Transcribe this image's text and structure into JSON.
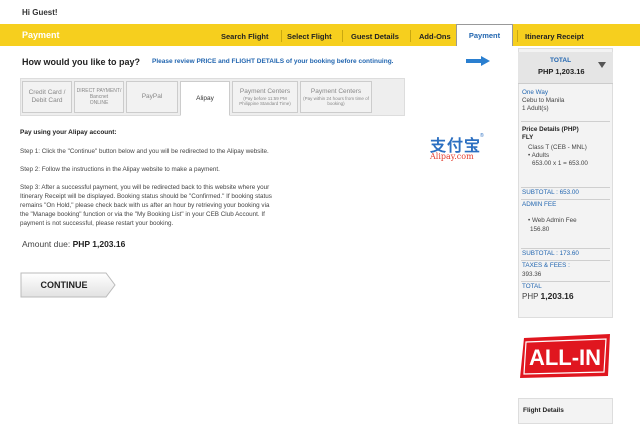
{
  "header": {
    "greeting": "Hi Guest!"
  },
  "nav": {
    "title": "Payment",
    "items": [
      "Search Flight",
      "Select Flight",
      "Guest Details",
      "Add-Ons",
      "Payment",
      "Itinerary Receipt"
    ],
    "active": "Payment"
  },
  "question": {
    "text": "How would you like to pay?",
    "note": "Please review PRICE and FLIGHT DETAILS of your booking before continuing."
  },
  "tabs": [
    {
      "main": "Credit Card / Debit Card",
      "sub": ""
    },
    {
      "main": "DIRECT PAYMENT/ Bancnet",
      "sub": "ONLINE"
    },
    {
      "main": "PayPal",
      "sub": ""
    },
    {
      "main": "Alipay",
      "sub": ""
    },
    {
      "main": "Payment Centers",
      "sub": "(Pay before 11:59 PM Philippine Standard Time)"
    },
    {
      "main": "Payment Centers",
      "sub": "(Pay within 24 hours from time of booking)"
    }
  ],
  "content": {
    "heading": "Pay using your Alipay account:",
    "step1": "Step 1: Click the \"Continue\" button below and you will be redirected to the Alipay website.",
    "step2": "Step 2: Follow the instructions in the Alipay website to make a payment.",
    "step3_l1": "Step 3: After a successful payment, you will be redirected back to this website where your",
    "step3_l2": "Itinerary Receipt will be displayed. Booking status should be \"Confirmed.\" If booking status",
    "step3_l3": "remains \"On Hold,\" please check back with us after an hour by retrieving your booking via",
    "step3_l4": "the \"Manage booking\" function or via the \"My Booking List\" in your CEB Club Account. If",
    "step3_l5": "payment is not successful, please restart your booking.",
    "amount_label": "Amount due:",
    "amount_value": "PHP 1,203.16",
    "continue_label": "CONTINUE",
    "logo_cn": "支付宝",
    "logo_en": "Alipay.com"
  },
  "sidebar": {
    "total_label": "TOTAL",
    "total_amount": "PHP 1,203.16",
    "trip_type": "One Way",
    "route": "Cebu to Manila",
    "pax": "1 Adult(s)",
    "price_details": "Price Details (PHP)",
    "fly": "FLY",
    "class": "Class T (CEB - MNL)",
    "adults": "• Adults",
    "adult_calc": "653.00 x 1 = 653.00",
    "subtotal1": "SUBTOTAL : 653.00",
    "admin_fee": "ADMIN FEE",
    "web_admin": "• Web Admin Fee",
    "web_admin_amt": "156.80",
    "subtotal2": "SUBTOTAL : 173.60",
    "taxes": "TAXES & FEES :",
    "taxes_amt": "393.36",
    "total2_label": "TOTAL",
    "total2_cur": "PHP",
    "total2_amt": "1,203.16",
    "allin_text": "ALL-IN",
    "flight_details": "Flight Details"
  },
  "colors": {
    "brand_yellow": "#f6cf1e",
    "link_blue": "#2266b0",
    "allin_red": "#e0161f"
  }
}
